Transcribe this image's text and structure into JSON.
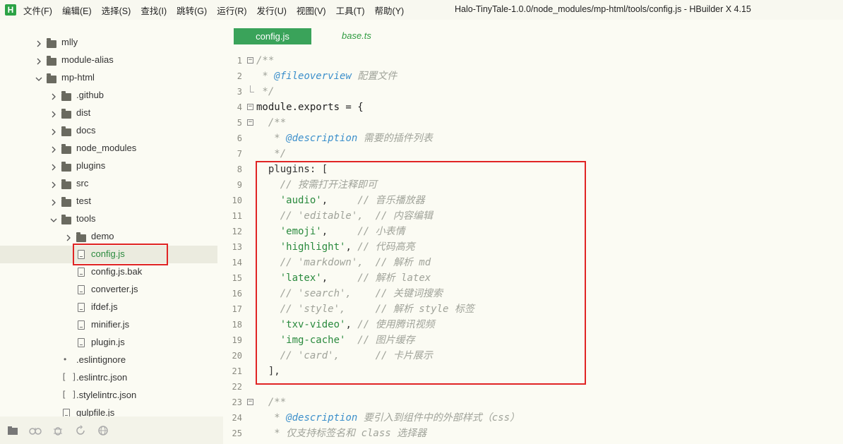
{
  "app": {
    "menu": [
      "文件(F)",
      "编辑(E)",
      "选择(S)",
      "查找(I)",
      "跳转(G)",
      "运行(R)",
      "发行(U)",
      "视图(V)",
      "工具(T)",
      "帮助(Y)"
    ],
    "window_title": "Halo-TinyTale-1.0.0/node_modules/mp-html/tools/config.js - HBuilder X 4.15",
    "logo": "H"
  },
  "tabs": [
    {
      "label": "config.js",
      "active": true
    },
    {
      "label": "base.ts",
      "active": false
    }
  ],
  "tree": [
    {
      "label": "mlly",
      "type": "folder",
      "depth": 0,
      "expanded": false
    },
    {
      "label": "module-alias",
      "type": "folder",
      "depth": 0,
      "expanded": false
    },
    {
      "label": "mp-html",
      "type": "folder",
      "depth": 0,
      "expanded": true
    },
    {
      "label": ".github",
      "type": "folder",
      "depth": 1,
      "expanded": false
    },
    {
      "label": "dist",
      "type": "folder",
      "depth": 1,
      "expanded": false
    },
    {
      "label": "docs",
      "type": "folder",
      "depth": 1,
      "expanded": false
    },
    {
      "label": "node_modules",
      "type": "folder",
      "depth": 1,
      "expanded": false
    },
    {
      "label": "plugins",
      "type": "folder",
      "depth": 1,
      "expanded": false
    },
    {
      "label": "src",
      "type": "folder",
      "depth": 1,
      "expanded": false
    },
    {
      "label": "test",
      "type": "folder",
      "depth": 1,
      "expanded": false
    },
    {
      "label": "tools",
      "type": "folder",
      "depth": 1,
      "expanded": true
    },
    {
      "label": "demo",
      "type": "folder",
      "depth": 2,
      "expanded": false
    },
    {
      "label": "config.js",
      "type": "file",
      "depth": 2,
      "selected": true
    },
    {
      "label": "config.js.bak",
      "type": "file",
      "depth": 2
    },
    {
      "label": "converter.js",
      "type": "file",
      "depth": 2
    },
    {
      "label": "ifdef.js",
      "type": "file",
      "depth": 2
    },
    {
      "label": "minifier.js",
      "type": "file",
      "depth": 2
    },
    {
      "label": "plugin.js",
      "type": "file",
      "depth": 2
    },
    {
      "label": ".eslintignore",
      "type": "dot",
      "depth": 1
    },
    {
      "label": ".eslintrc.json",
      "type": "json",
      "depth": 1
    },
    {
      "label": ".stylelintrc.json",
      "type": "json",
      "depth": 1
    },
    {
      "label": "gulpfile.js",
      "type": "file",
      "depth": 1
    }
  ],
  "code_lines": [
    {
      "n": "1",
      "fold": "open",
      "parts": [
        [
          "c-comment",
          "/**"
        ]
      ]
    },
    {
      "n": "2",
      "parts": [
        [
          "c-comment",
          " * "
        ],
        [
          "c-tag",
          "@fileoverview"
        ],
        [
          "c-comment",
          " 配置文件"
        ]
      ]
    },
    {
      "n": "3",
      "fold": "end",
      "parts": [
        [
          "c-comment",
          " */"
        ]
      ]
    },
    {
      "n": "4",
      "fold": "open",
      "parts": [
        [
          "c-kw",
          "module.exports = {"
        ]
      ]
    },
    {
      "n": "5",
      "fold": "open",
      "parts": [
        [
          "c-comment",
          "  /**"
        ]
      ]
    },
    {
      "n": "6",
      "parts": [
        [
          "c-comment",
          "   * "
        ],
        [
          "c-tag",
          "@description"
        ],
        [
          "c-comment",
          " 需要的插件列表"
        ]
      ]
    },
    {
      "n": "7",
      "parts": [
        [
          "c-comment",
          "   */"
        ]
      ]
    },
    {
      "n": "8",
      "parts": [
        [
          "c-key",
          "  plugins: ["
        ]
      ]
    },
    {
      "n": "9",
      "parts": [
        [
          "c-comment",
          "    // 按需打开注释即可"
        ]
      ]
    },
    {
      "n": "10",
      "parts": [
        [
          "c-punct",
          "    "
        ],
        [
          "c-str",
          "'audio'"
        ],
        [
          "c-punct",
          ",     "
        ],
        [
          "c-comment",
          "// 音乐播放器"
        ]
      ]
    },
    {
      "n": "11",
      "parts": [
        [
          "c-comment",
          "    // 'editable',  // 内容编辑"
        ]
      ]
    },
    {
      "n": "12",
      "parts": [
        [
          "c-punct",
          "    "
        ],
        [
          "c-str",
          "'emoji'"
        ],
        [
          "c-punct",
          ",     "
        ],
        [
          "c-comment",
          "// 小表情"
        ]
      ]
    },
    {
      "n": "13",
      "parts": [
        [
          "c-punct",
          "    "
        ],
        [
          "c-str",
          "'highlight'"
        ],
        [
          "c-punct",
          ", "
        ],
        [
          "c-comment",
          "// 代码高亮"
        ]
      ]
    },
    {
      "n": "14",
      "parts": [
        [
          "c-comment",
          "    // 'markdown',  // 解析 md"
        ]
      ]
    },
    {
      "n": "15",
      "parts": [
        [
          "c-punct",
          "    "
        ],
        [
          "c-str",
          "'latex'"
        ],
        [
          "c-punct",
          ",     "
        ],
        [
          "c-comment",
          "// 解析 latex"
        ]
      ]
    },
    {
      "n": "16",
      "parts": [
        [
          "c-comment",
          "    // 'search',    // 关键词搜索"
        ]
      ]
    },
    {
      "n": "17",
      "parts": [
        [
          "c-comment",
          "    // 'style',     // 解析 style 标签"
        ]
      ]
    },
    {
      "n": "18",
      "parts": [
        [
          "c-punct",
          "    "
        ],
        [
          "c-str",
          "'txv-video'"
        ],
        [
          "c-punct",
          ", "
        ],
        [
          "c-comment",
          "// 使用腾讯视频"
        ]
      ]
    },
    {
      "n": "19",
      "parts": [
        [
          "c-punct",
          "    "
        ],
        [
          "c-str",
          "'img-cache'"
        ],
        [
          "c-punct",
          "  "
        ],
        [
          "c-comment",
          "// 图片缓存"
        ]
      ]
    },
    {
      "n": "20",
      "parts": [
        [
          "c-comment",
          "    // 'card',      // 卡片展示"
        ]
      ]
    },
    {
      "n": "21",
      "parts": [
        [
          "c-punct",
          "  ],"
        ]
      ]
    },
    {
      "n": "22",
      "parts": [
        [
          "c-punct",
          ""
        ]
      ]
    },
    {
      "n": "23",
      "fold": "open",
      "parts": [
        [
          "c-comment",
          "  /**"
        ]
      ]
    },
    {
      "n": "24",
      "parts": [
        [
          "c-comment",
          "   * "
        ],
        [
          "c-tag",
          "@description"
        ],
        [
          "c-comment",
          " 要引入到组件中的外部样式（css）"
        ]
      ]
    },
    {
      "n": "25",
      "parts": [
        [
          "c-comment",
          "   * 仅支持标签名和 class 选择器"
        ]
      ]
    }
  ],
  "colors": {
    "accent": "#3aa35a",
    "highlight_box": "#e02424",
    "string": "#2a8a3e",
    "doc_tag": "#3c8fcb",
    "comment": "#a0a39a"
  },
  "bottom_icons": [
    "files-icon",
    "robot-icon",
    "bug-icon",
    "refresh-icon",
    "globe-icon"
  ]
}
